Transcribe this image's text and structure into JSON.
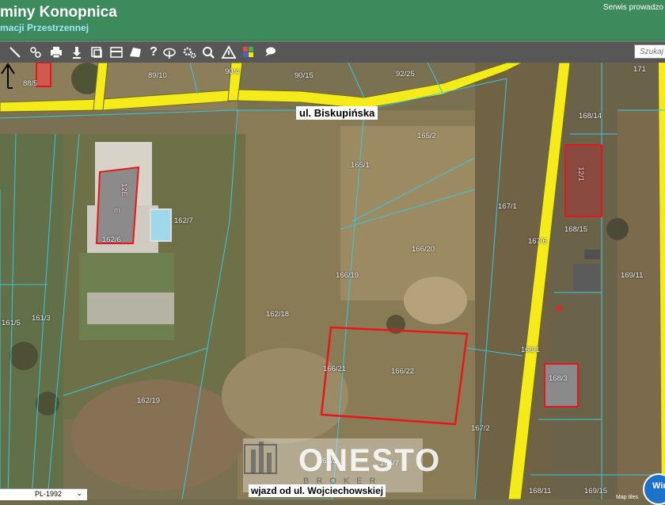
{
  "header": {
    "title": "miny Konopnica",
    "subtitle": "macji Przestrzennej",
    "service_text": "Serwis prowadzo"
  },
  "toolbar": {
    "tools": [
      "measure-line-icon",
      "link-icon",
      "print-icon",
      "download-icon",
      "layers-icon",
      "table-icon",
      "shape-icon",
      "help-icon",
      "upload-cloud-icon",
      "settings-icon",
      "zoom-search-icon",
      "warning-icon",
      "color-grid-icon",
      "comment-icon"
    ],
    "help_glyph": "?",
    "search_placeholder": "Szukaj"
  },
  "map": {
    "street_label": "ul. Biskupińska",
    "access_label": "wjazd od ul. Wojciechowskiej",
    "parcels": [
      "88/5",
      "89/10",
      "90/4",
      "90/15",
      "92/25",
      "171",
      "165/2",
      "168/14",
      "165/1",
      "167/1",
      "162/7",
      "162/6",
      "167/6",
      "168/15",
      "166/20",
      "166/19",
      "169/11",
      "162/18",
      "161/3",
      "161/5",
      "166/21",
      "166/22",
      "168/1",
      "168/3",
      "162/19",
      "167/2",
      "166/3",
      "166/7",
      "168/11",
      "169/15"
    ],
    "building_marks": [
      "12E",
      "12/1",
      "m"
    ],
    "highlight_color": "#e8161c",
    "road_color": "#f5ea1a"
  },
  "watermark": {
    "name": "ONESTO",
    "sub": "BROKER"
  },
  "statusbar": {
    "crs": "PL-1992"
  },
  "map_tiles_text": "Map tiles",
  "win_button": "Win"
}
